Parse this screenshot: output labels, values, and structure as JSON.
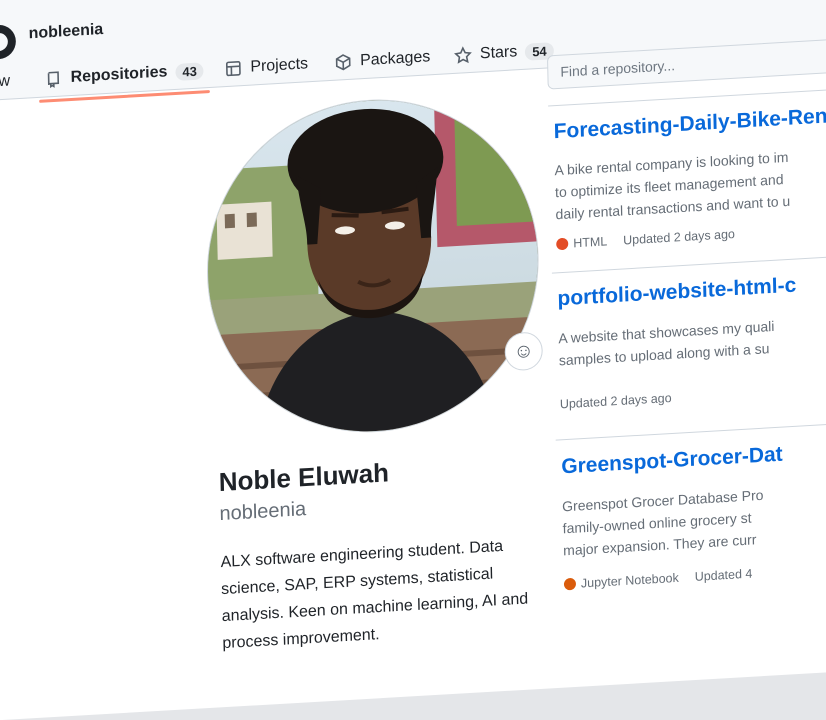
{
  "header": {
    "username": "nobleenia",
    "tabs": [
      {
        "label": "rview",
        "icon": "book-icon"
      },
      {
        "label": "Repositories",
        "icon": "repo-icon",
        "count": "43",
        "active": true
      },
      {
        "label": "Projects",
        "icon": "table-icon"
      },
      {
        "label": "Packages",
        "icon": "package-icon"
      },
      {
        "label": "Stars",
        "icon": "star-icon",
        "count": "54"
      }
    ]
  },
  "profile": {
    "full_name": "Noble Eluwah",
    "login": "nobleenia",
    "bio": "ALX software engineering student. Data science, SAP, ERP systems, statistical analysis. Keen on machine learning, AI and process improvement."
  },
  "repos": {
    "search_placeholder": "Find a repository...",
    "items": [
      {
        "name": "Forecasting-Daily-Bike-Ren",
        "description": "A bike rental company is looking to im\nto optimize its fleet management and\ndaily rental transactions and want to u",
        "language": "HTML",
        "language_color": "#e34c26",
        "updated": "Updated 2 days ago"
      },
      {
        "name": "portfolio-website-html-c",
        "description": "A website that showcases my quali\nsamples to upload along with a su",
        "updated": "Updated 2 days ago"
      },
      {
        "name": "Greenspot-Grocer-Dat",
        "description": "Greenspot Grocer Database Pro\nfamily-owned online grocery st\nmajor expansion. They are curr",
        "language": "Jupyter Notebook",
        "language_color": "#da5b0b",
        "updated": "Updated 4"
      }
    ]
  },
  "colors": {
    "link": "#0969da",
    "active_tab_underline": "#fd8c73",
    "muted_text": "#656d76"
  }
}
